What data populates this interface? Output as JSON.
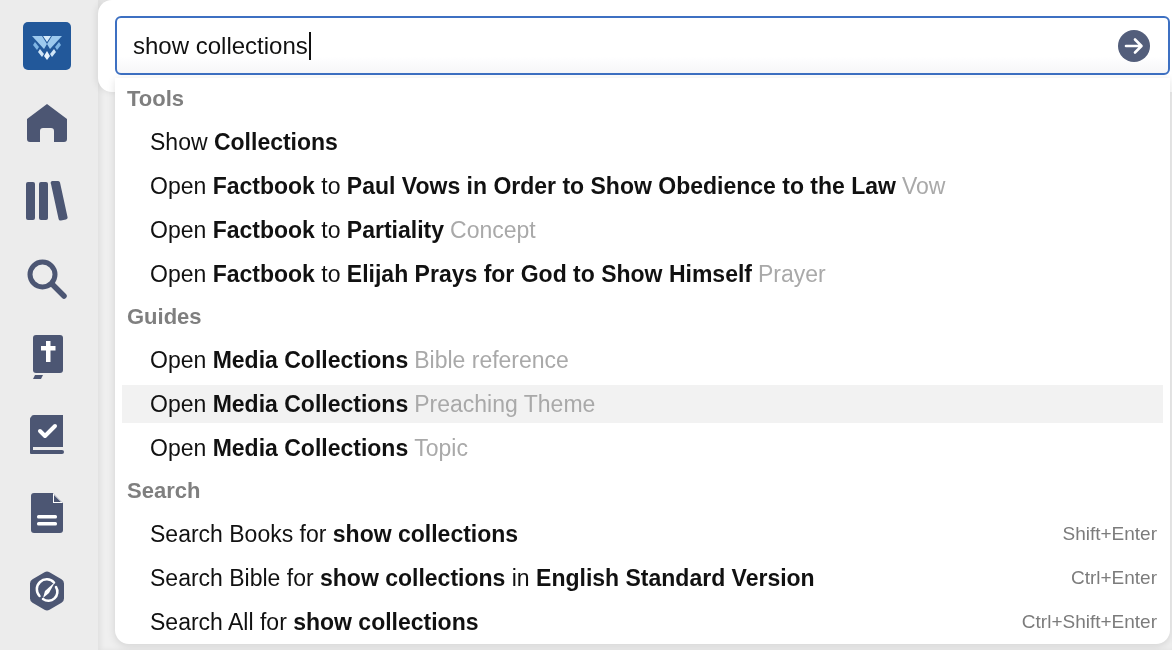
{
  "search": {
    "value": "show collections"
  },
  "results": [
    {
      "title": "Tools",
      "items": [
        {
          "text": "Show **Collections**",
          "selected": false
        },
        {
          "text": "Open **Factbook** to **Paul Vows in Order to Show Obedience to the Law**",
          "category": "Vow",
          "selected": false
        },
        {
          "text": "Open **Factbook** to **Partiality**",
          "category": "Concept",
          "selected": false
        },
        {
          "text": "Open **Factbook** to **Elijah Prays for God to Show Himself**",
          "category": "Prayer",
          "selected": false
        }
      ]
    },
    {
      "title": "Guides",
      "items": [
        {
          "text": "Open **Media Collections**",
          "category": "Bible reference",
          "selected": false
        },
        {
          "text": "Open **Media Collections**",
          "category": "Preaching Theme",
          "selected": true
        },
        {
          "text": "Open **Media Collections**",
          "category": "Topic",
          "selected": false
        }
      ]
    },
    {
      "title": "Search",
      "items": [
        {
          "text": "Search Books for **show collections**",
          "shortcut": "Shift+Enter",
          "selected": false
        },
        {
          "text": "Search Bible for **show collections** in **English Standard Version**",
          "shortcut": "Ctrl+Enter",
          "selected": false
        },
        {
          "text": "Search All for **show collections**",
          "shortcut": "Ctrl+Shift+Enter",
          "selected": false
        }
      ]
    }
  ]
}
